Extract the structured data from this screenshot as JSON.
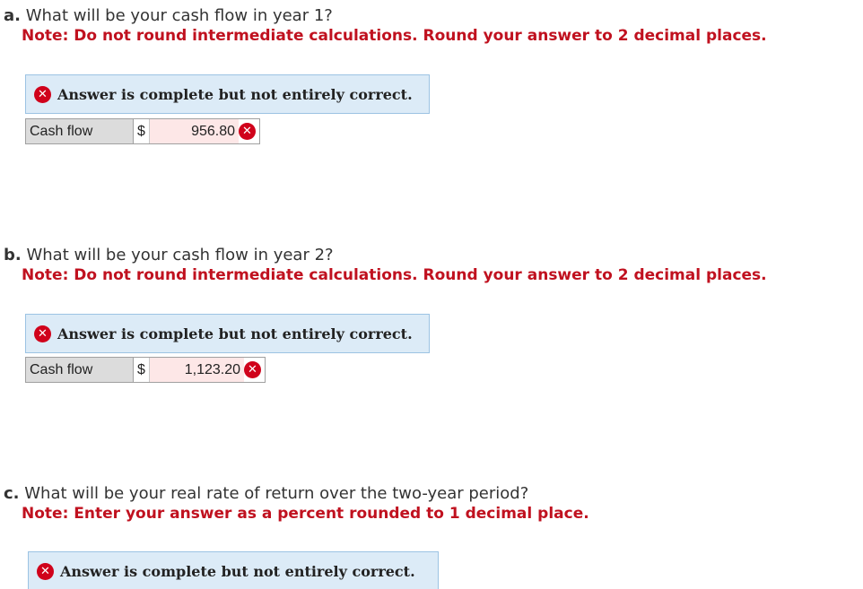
{
  "questions": [
    {
      "letter": "a.",
      "text": "What will be your cash flow in year 1?",
      "note": "Note: Do not round intermediate calculations. Round your answer to 2 decimal places.",
      "banner": "Answer is complete but not entirely correct.",
      "row_label": "Cash flow",
      "currency": "$",
      "value": "956.80"
    },
    {
      "letter": "b.",
      "text": "What will be your cash flow in year 2?",
      "note": "Note: Do not round intermediate calculations. Round your answer to 2 decimal places.",
      "banner": "Answer is complete but not entirely correct.",
      "row_label": "Cash flow",
      "currency": "$",
      "value": "1,123.20"
    },
    {
      "letter": "c.",
      "text": "What will be your real rate of return over the two-year period?",
      "note": "Note: Enter your answer as a percent rounded to 1 decimal place.",
      "banner": "Answer is complete but not entirely correct."
    }
  ],
  "icons": {
    "incorrect": "close-circle-icon"
  },
  "colors": {
    "note_red": "#c0111f",
    "banner_bg": "#dcebf7",
    "banner_border": "#9cc3e3",
    "error_icon": "#d0021b",
    "label_bg": "#dcdcdc"
  }
}
